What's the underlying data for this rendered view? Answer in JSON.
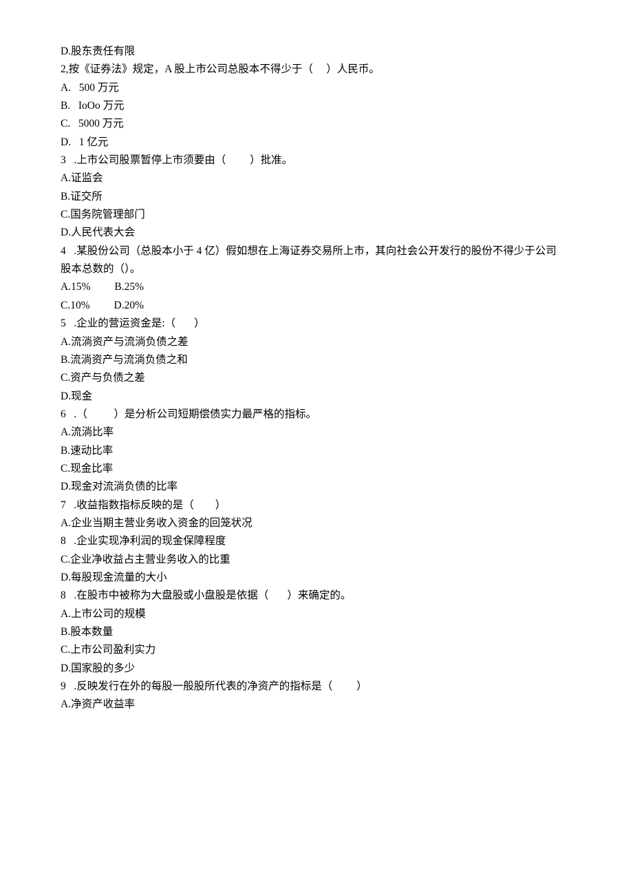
{
  "lines": [
    "D.股东责任有限",
    "2,按《证券法》规定，A 股上市公司总股本不得少于（     ）人民币。",
    "A.   500 万元",
    "B.   IoOo 万元",
    "C.   5000 万元",
    "D.   1 亿元",
    "3   .上市公司股票暂停上市须要由（         ）批准。",
    "A.证监会",
    "B.证交所",
    "C.国务院管理部门",
    "D.人民代表大会",
    "4   .某股份公司（总股本小于 4 亿）假如想在上海证券交易所上市，其向社会公开发行的股份不得少于公司",
    "股本总数的（）。",
    "A.15%         B.25%",
    "C.10%         D.20%",
    "5   .企业的营运资金是:（       ）",
    "A.流淌资产与流淌负债之差",
    "B.流淌资产与流淌负债之和",
    "C.资产与负债之差",
    "D.现金",
    "6   .（          ）是分析公司短期偿债实力最严格的指标。",
    "A.流淌比率",
    "B.速动比率",
    "C.现金比率",
    "D.现金对流淌负债的比率",
    "",
    "7   .收益指数指标反映的是（        ）",
    "",
    "A.企业当期主营业务收入资金的回笼状况",
    "8   .企业实现净利润的现金保障程度",
    "C.企业净收益占主营业务收入的比重",
    "D.每股现金流量的大小",
    "8   .在股市中被称为大盘股或小盘股是依据（       ）来确定的。",
    "A.上市公司的规模",
    "B.股本数量",
    "C.上市公司盈利实力",
    "D.国家股的多少",
    "9   .反映发行在外的每股一般股所代表的净资产的指标是（         ）",
    "A.净资产收益率"
  ]
}
